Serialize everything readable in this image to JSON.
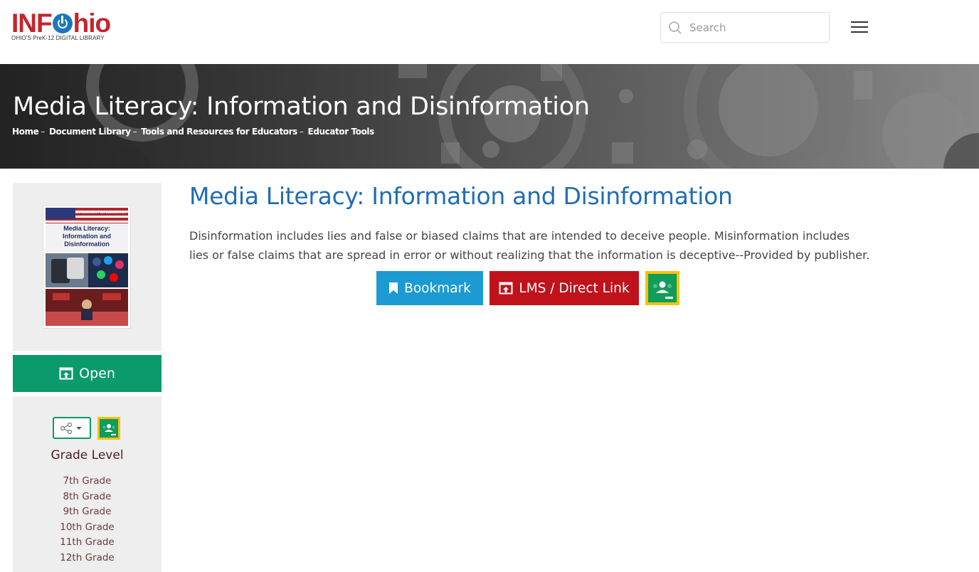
{
  "header": {
    "logo": {
      "main": "INFOhio",
      "tagline": "OHIO'S PreK-12 DIGITAL LIBRARY"
    },
    "search": {
      "placeholder": "Search",
      "value": ""
    },
    "menu_icon": "hamburger-menu-icon"
  },
  "banner": {
    "title": "Media Literacy: Information and Disinformation",
    "breadcrumb": [
      "Home",
      "Document Library",
      "Tools and Resources for Educators",
      "Educator Tools"
    ],
    "separator": "–"
  },
  "sidebar": {
    "cover": {
      "series": "CHALLENGES FOR DEMOCRACY",
      "title_line1": "Media Literacy:",
      "title_line2": "Information and",
      "title_line3": "Disinformation"
    },
    "open_label": "Open",
    "grade_level_title": "Grade Level",
    "grades": [
      "7th Grade",
      "8th Grade",
      "9th Grade",
      "10th Grade",
      "11th Grade",
      "12th Grade"
    ]
  },
  "main": {
    "title": "Media Literacy: Information and Disinformation",
    "description": "Disinformation includes lies and false or biased claims that are intended to deceive people. Misinformation includes lies or false claims that are spread in error or without realizing that the information is deceptive--Provided by publisher.",
    "bookmark_label": "Bookmark",
    "lms_label": "LMS / Direct Link"
  },
  "colors": {
    "brand_red": "#c4252d",
    "brand_blue": "#1c76bd",
    "title_blue": "#1f6db5",
    "open_green": "#0a9a6c",
    "bookmark_blue": "#1b9bd1",
    "lms_red": "#c0121b",
    "classroom_green": "#0f9d58",
    "classroom_yellow": "#f4c20d"
  }
}
